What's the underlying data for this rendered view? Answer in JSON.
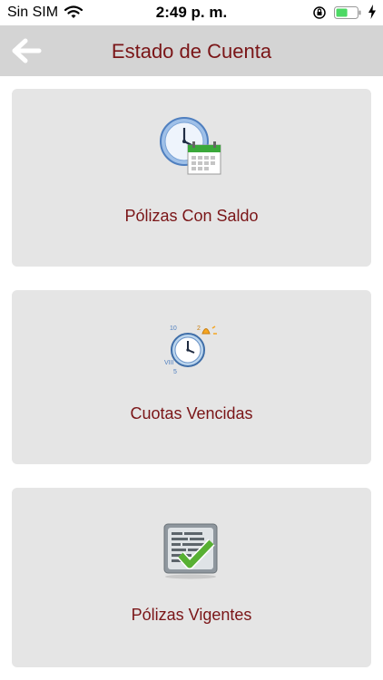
{
  "status_bar": {
    "carrier": "Sin SIM",
    "time": "2:49 p. m.",
    "battery_level": 0.55,
    "icons": [
      "wifi-icon",
      "orientation-lock-icon",
      "battery-icon",
      "charging-bolt-icon"
    ]
  },
  "header": {
    "title": "Estado de Cuenta",
    "back_icon": "back-arrow-icon"
  },
  "cards": [
    {
      "label": "Pólizas Con Saldo",
      "icon": "clock-calendar-icon"
    },
    {
      "label": "Cuotas Vencidas",
      "icon": "alarm-clock-icon"
    },
    {
      "label": "Pólizas Vigentes",
      "icon": "document-check-icon"
    }
  ],
  "colors": {
    "accent": "#7a1517",
    "header_bg": "#d4d4d4",
    "card_bg": "#e5e5e5",
    "battery": "#4cd964"
  }
}
